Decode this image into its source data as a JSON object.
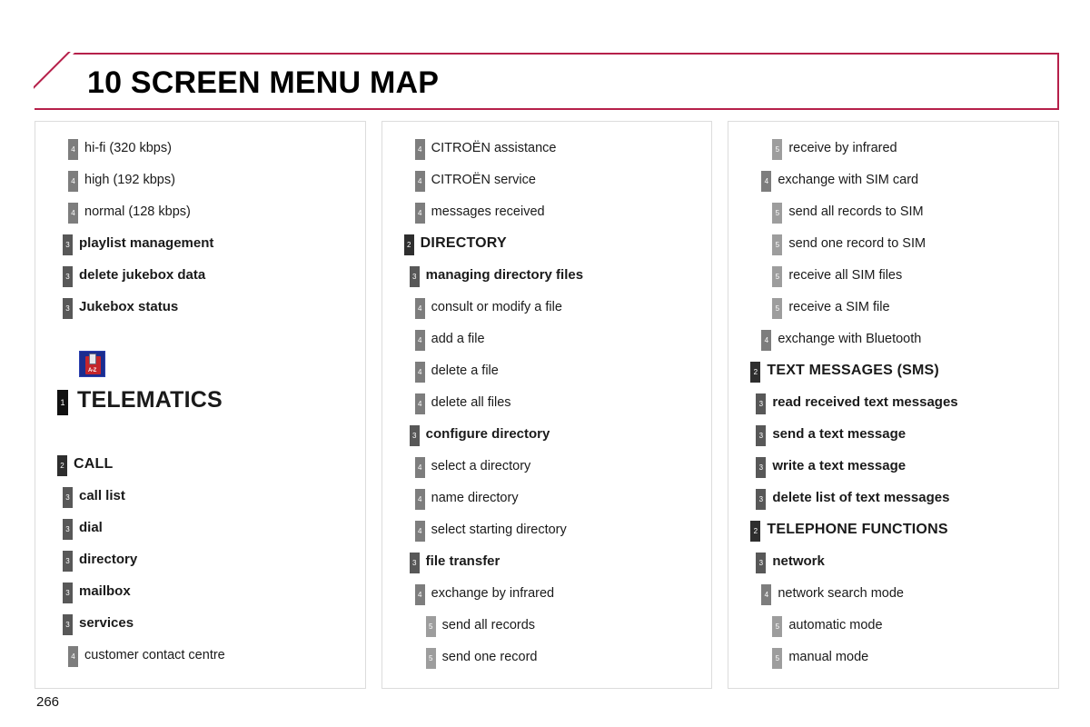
{
  "header": {
    "title": "10 SCREEN MENU MAP",
    "accent_color": "#b6204a"
  },
  "page_number": "266",
  "level_colors": {
    "1": "#111111",
    "2": "#2e2e2e",
    "3": "#585858",
    "4": "#7d7d7d",
    "5": "#9d9d9d"
  },
  "columns": [
    {
      "id": "column-1",
      "items": [
        {
          "level": 4,
          "label": "hi-fi (320 kbps)"
        },
        {
          "level": 4,
          "label": "high (192 kbps)"
        },
        {
          "level": 4,
          "label": "normal (128 kbps)"
        },
        {
          "level": 3,
          "label": "playlist management"
        },
        {
          "level": 3,
          "label": "delete jukebox data"
        },
        {
          "level": 3,
          "label": "Jukebox status"
        },
        {
          "icon": "telematics-directory-icon",
          "icon_label": "A-Z"
        },
        {
          "level": 1,
          "label": "TELEMATICS"
        },
        {
          "level": 2,
          "label": "CALL",
          "gap_before": true
        },
        {
          "level": 3,
          "label": "call list"
        },
        {
          "level": 3,
          "label": "dial"
        },
        {
          "level": 3,
          "label": "directory"
        },
        {
          "level": 3,
          "label": "mailbox"
        },
        {
          "level": 3,
          "label": "services"
        },
        {
          "level": 4,
          "label": "customer contact centre"
        }
      ]
    },
    {
      "id": "column-2",
      "items": [
        {
          "level": 4,
          "label": "CITROËN assistance"
        },
        {
          "level": 4,
          "label": "CITROËN service"
        },
        {
          "level": 4,
          "label": "messages received"
        },
        {
          "level": 2,
          "label": "DIRECTORY"
        },
        {
          "level": 3,
          "label": "managing directory files"
        },
        {
          "level": 4,
          "label": "consult or modify a file"
        },
        {
          "level": 4,
          "label": "add a file"
        },
        {
          "level": 4,
          "label": "delete a file"
        },
        {
          "level": 4,
          "label": "delete all files"
        },
        {
          "level": 3,
          "label": "configure directory"
        },
        {
          "level": 4,
          "label": "select a directory"
        },
        {
          "level": 4,
          "label": "name directory"
        },
        {
          "level": 4,
          "label": "select starting directory"
        },
        {
          "level": 3,
          "label": "file transfer"
        },
        {
          "level": 4,
          "label": "exchange by infrared"
        },
        {
          "level": 5,
          "label": "send all records"
        },
        {
          "level": 5,
          "label": "send one record"
        }
      ]
    },
    {
      "id": "column-3",
      "items": [
        {
          "level": 5,
          "label": "receive by infrared"
        },
        {
          "level": 4,
          "label": "exchange with SIM card"
        },
        {
          "level": 5,
          "label": "send all records to SIM"
        },
        {
          "level": 5,
          "label": "send one record to SIM"
        },
        {
          "level": 5,
          "label": "receive all SIM files"
        },
        {
          "level": 5,
          "label": "receive a SIM file"
        },
        {
          "level": 4,
          "label": "exchange with Bluetooth"
        },
        {
          "level": 2,
          "label": "TEXT MESSAGES (SMS)"
        },
        {
          "level": 3,
          "label": "read received text messages"
        },
        {
          "level": 3,
          "label": "send a text message"
        },
        {
          "level": 3,
          "label": "write a text message"
        },
        {
          "level": 3,
          "label": "delete list of text messages"
        },
        {
          "level": 2,
          "label": "TELEPHONE FUNCTIONS"
        },
        {
          "level": 3,
          "label": "network"
        },
        {
          "level": 4,
          "label": "network search mode"
        },
        {
          "level": 5,
          "label": "automatic mode"
        },
        {
          "level": 5,
          "label": "manual mode"
        }
      ]
    }
  ]
}
